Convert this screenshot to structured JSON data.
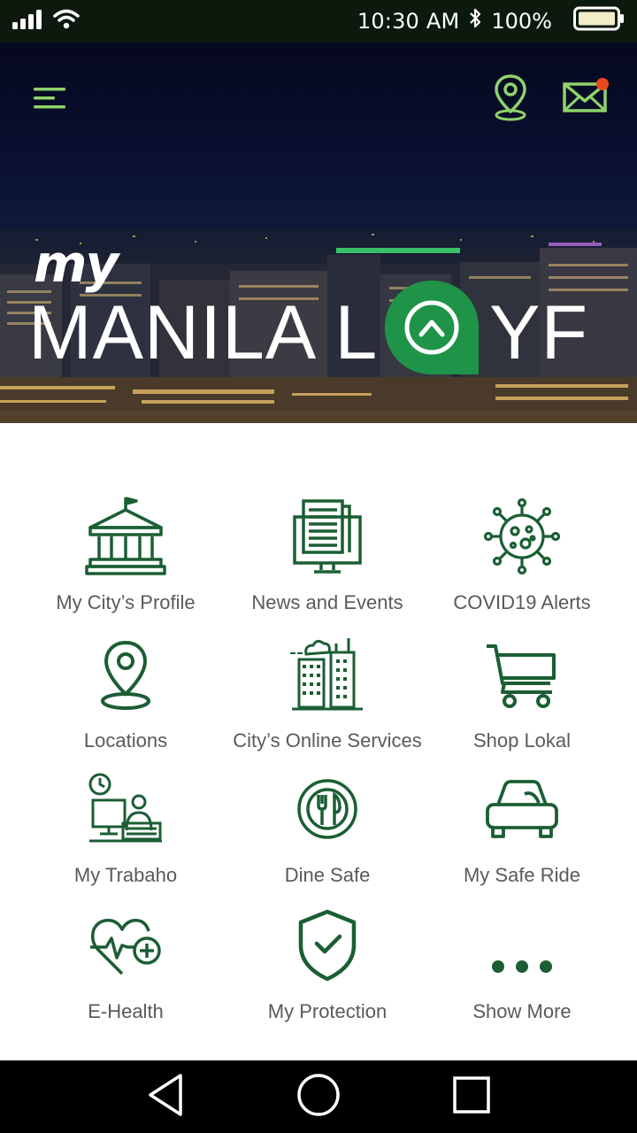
{
  "status_bar": {
    "time": "10:30 AM",
    "battery": "100%",
    "icons": [
      "signal-icon",
      "wifi-icon",
      "bluetooth-icon",
      "battery-icon"
    ]
  },
  "header": {
    "icons": [
      "menu-icon",
      "location-pin-icon",
      "mail-icon"
    ],
    "brand_my": "my",
    "brand_left": "MANILA L",
    "brand_right": "YF"
  },
  "colors": {
    "primary_green": "#1b5e34",
    "accent_green": "#8fd36a",
    "logo_green": "#1f9448",
    "badge": "#e84a1b",
    "label_gray": "#5a5a5a"
  },
  "grid": {
    "items": [
      {
        "label": "My City’s Profile",
        "icon": "city-hall-icon"
      },
      {
        "label": "News and Events",
        "icon": "newspaper-icon"
      },
      {
        "label": "COVID19 Alerts",
        "icon": "virus-icon"
      },
      {
        "label": "Locations",
        "icon": "location-icon"
      },
      {
        "label": "City’s Online Services",
        "icon": "buildings-icon"
      },
      {
        "label": "Shop Lokal",
        "icon": "shopping-cart-icon"
      },
      {
        "label": "My Trabaho",
        "icon": "worker-desk-icon"
      },
      {
        "label": "Dine Safe",
        "icon": "plate-cutlery-icon"
      },
      {
        "label": "My Safe Ride",
        "icon": "car-icon"
      },
      {
        "label": "E-Health",
        "icon": "heart-pulse-icon"
      },
      {
        "label": "My Protection",
        "icon": "shield-check-icon"
      },
      {
        "label": "Show More",
        "icon": "more-dots-icon"
      }
    ]
  },
  "nav_bar": {
    "icons": [
      "back-icon",
      "home-icon",
      "recents-icon"
    ]
  }
}
